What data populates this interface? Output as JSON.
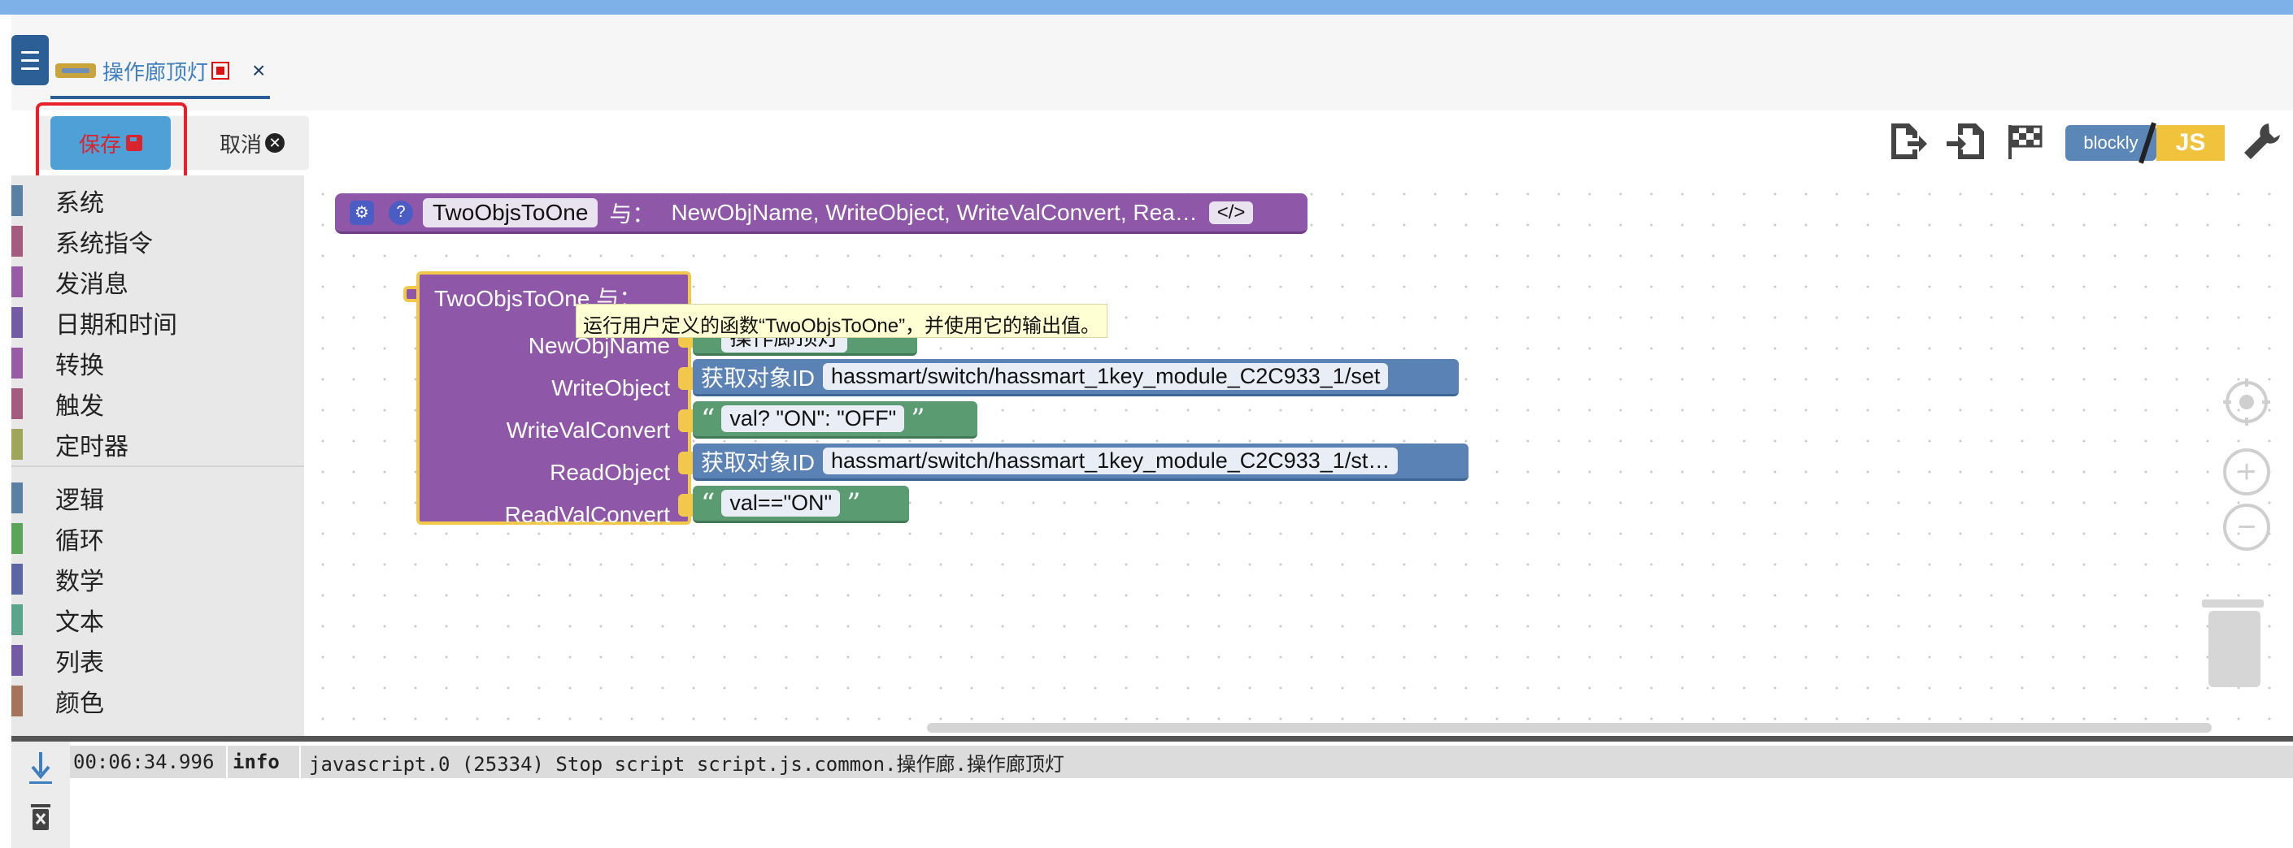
{
  "tab": {
    "title": "操作廊顶灯",
    "close": "×"
  },
  "toolbar": {
    "save_label": "保存",
    "cancel_label": "取消",
    "cancel_symbol": "✕",
    "blockly_label": "blockly",
    "js_label": "JS"
  },
  "sidebar": {
    "items": [
      {
        "label": "系统",
        "color": "#5b80a5"
      },
      {
        "label": "系统指令",
        "color": "#a55b80"
      },
      {
        "label": "发消息",
        "color": "#995ba5"
      },
      {
        "label": "日期和时间",
        "color": "#745ba5"
      },
      {
        "label": "转换",
        "color": "#995ba5"
      },
      {
        "label": "触发",
        "color": "#a55b80"
      },
      {
        "label": "定时器",
        "color": "#9fa55b"
      },
      {
        "label": "逻辑",
        "color": "#5b80a5"
      },
      {
        "label": "循环",
        "color": "#5ba55b"
      },
      {
        "label": "数学",
        "color": "#5b67a5"
      },
      {
        "label": "文本",
        "color": "#5ba58c"
      },
      {
        "label": "列表",
        "color": "#745ba5"
      },
      {
        "label": "颜色",
        "color": "#a5745b"
      }
    ]
  },
  "workspace": {
    "definition": {
      "gear": "⚙",
      "help": "?",
      "name": "TwoObjsToOne",
      "with": "与：",
      "params": "NewObjName, WriteObject, WriteValConvert, Rea…",
      "code": "</>"
    },
    "call": {
      "title": "TwoObjsToOne  与：",
      "params": {
        "p1": "NewObjName",
        "p2": "WriteObject",
        "p3": "WriteValConvert",
        "p4": "ReadObject",
        "p5": "ReadValConvert"
      },
      "p1_value": "操作廊顶灯",
      "get_id_label": "获取对象ID",
      "write_object": "hassmart/switch/hassmart_1key_module_C2C933_1/set",
      "write_val_convert": "val? \"ON\": \"OFF\"",
      "read_object": "hassmart/switch/hassmart_1key_module_C2C933_1/st…",
      "read_val_convert": "val==\"ON\"",
      "open_quote": "“",
      "close_quote": "”"
    },
    "tooltip": "运行用户定义的函数“TwoObjsToOne”，并使用它的输出值。",
    "controls": {
      "zoom_in": "+",
      "zoom_out": "−"
    }
  },
  "console": {
    "time": "00:06:34.996",
    "level": "info",
    "message": "javascript.0 (25334) Stop script script.js.common.操作廊.操作廊顶灯"
  },
  "colors": {
    "accent": "#2b5f95",
    "highlight": "#e8202a",
    "procedure": "#8f57a8",
    "object_block": "#5b82b5",
    "text_block": "#5a9b72"
  }
}
